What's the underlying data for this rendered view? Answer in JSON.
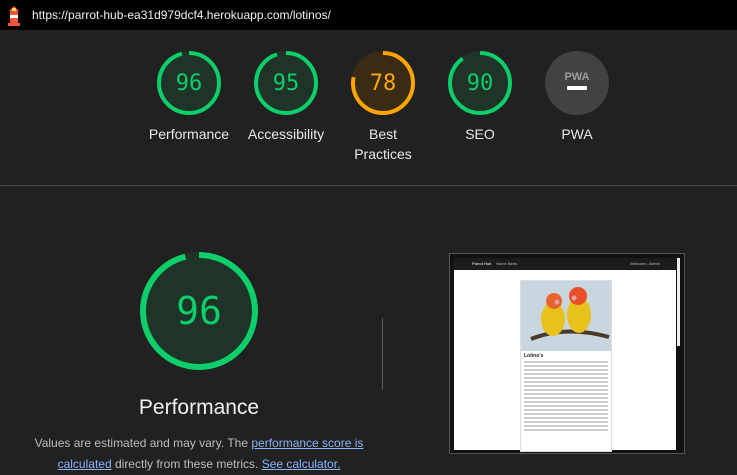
{
  "browser": {
    "url": "https://parrot-hub-ea31d979dcf4.herokuapp.com/lotinos/"
  },
  "gauges": [
    {
      "score": "96",
      "label": "Performance",
      "color": "#0cce6b"
    },
    {
      "score": "95",
      "label": "Accessibility",
      "color": "#0cce6b"
    },
    {
      "score": "78",
      "label": "Best Practices",
      "color": "#ffa400"
    },
    {
      "score": "90",
      "label": "SEO",
      "color": "#0cce6b"
    },
    {
      "score": "PWA",
      "label": "PWA",
      "color": "#757575"
    }
  ],
  "performance": {
    "score": "96",
    "title": "Performance",
    "desc_part1": "Values are estimated and may vary. The ",
    "link1": "performance score is calculated",
    "desc_part2": " directly from these metrics. ",
    "link2": "See calculator."
  },
  "screenshot": {
    "brand": "Parrot Hub",
    "nav_home": "Home",
    "nav_birds": "Birds",
    "user": "Welcome, Admin",
    "heading": "Lotino's"
  }
}
